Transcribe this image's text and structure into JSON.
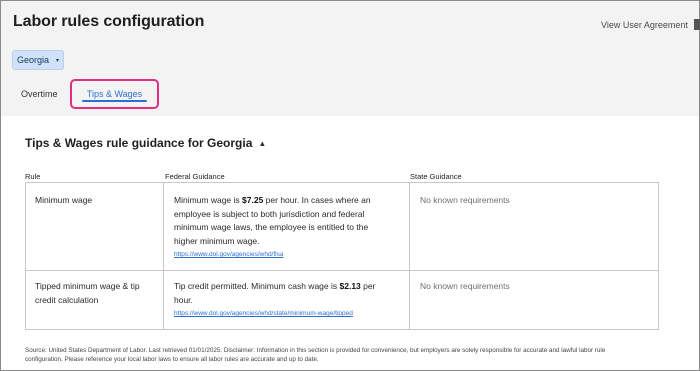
{
  "header": {
    "title": "Labor rules configuration",
    "agreement_link": "View User Agreement",
    "agreement_icon": "document-icon"
  },
  "state_select": {
    "value": "Georgia"
  },
  "tabs": [
    {
      "label": "Overtime",
      "active": false
    },
    {
      "label": "Tips & Wages",
      "active": true
    }
  ],
  "section": {
    "title": "Tips & Wages rule guidance for Georgia"
  },
  "table": {
    "headers": [
      "Rule",
      "Federal Guidance",
      "State Guidance"
    ],
    "rows": [
      {
        "rule": "Minimum wage",
        "federal_line1_pre": "Minimum wage is ",
        "federal_line1_bold": "$7.25",
        "federal_line1_post": " per hour. In cases where an",
        "federal_line2": "employee is subject to both jurisdiction and federal",
        "federal_line3": "minimum wage laws, the employee is entitled to the",
        "federal_line4": "higher minimum wage.",
        "federal_link": "https://www.dol.gov/agencies/whd/flsa",
        "state": "No known requirements"
      },
      {
        "rule_line1": "Tipped minimum wage & tip",
        "rule_line2": "credit calculation",
        "federal_line1_pre": "Tip credit permitted. Minimum cash wage is ",
        "federal_line1_bold": "$2.13",
        "federal_line1_post": " per",
        "federal_line2": "hour.",
        "federal_link": "https://www.dol.gov/agencies/whd/state/minimum-wage/tipped",
        "state": "No known requirements"
      }
    ]
  },
  "footnote": {
    "line1": "Source: United States Department of Labor. Last retrieved 01/01/2025. Disclaimer: Information in this section is provided for convenience, but employers are solely responsible for accurate and lawful labor rule",
    "line2": "configuration. Please reference your local labor laws to ensure all labor rules are accurate and up to date."
  },
  "colors": {
    "accent": "#2d6fd1",
    "highlight_border": "#e0307f",
    "chip_bg": "#cfe2f7",
    "header_bg": "#f3f3f3"
  }
}
